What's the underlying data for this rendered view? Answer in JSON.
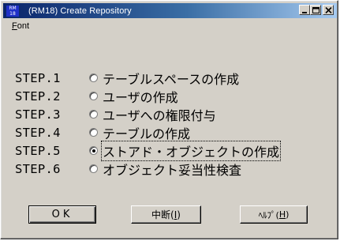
{
  "window": {
    "title": "(RM18) Create Repository",
    "icon_text": [
      "RM",
      "18"
    ]
  },
  "menu": {
    "font_label": "Font",
    "font_accel": "F",
    "font_rest": "ont"
  },
  "steps": [
    {
      "label": "STEP.1",
      "text": "テーブルスペースの作成",
      "selected": false
    },
    {
      "label": "STEP.2",
      "text": "ユーザの作成",
      "selected": false
    },
    {
      "label": "STEP.3",
      "text": "ユーザへの権限付与",
      "selected": false
    },
    {
      "label": "STEP.4",
      "text": "テーブルの作成",
      "selected": false
    },
    {
      "label": "STEP.5",
      "text": "ストアド・オブジェクトの作成",
      "selected": true
    },
    {
      "label": "STEP.6",
      "text": "オブジェクト妥当性検査",
      "selected": false
    }
  ],
  "buttons": {
    "ok": "OK",
    "abort": "中断(I)",
    "abort_main": "中断(",
    "abort_accel": "I",
    "abort_end": ")",
    "help": "ﾍﾙﾌﾟ(H)",
    "help_main": "ﾍﾙﾌﾟ(",
    "help_accel": "H",
    "help_end": ")"
  }
}
